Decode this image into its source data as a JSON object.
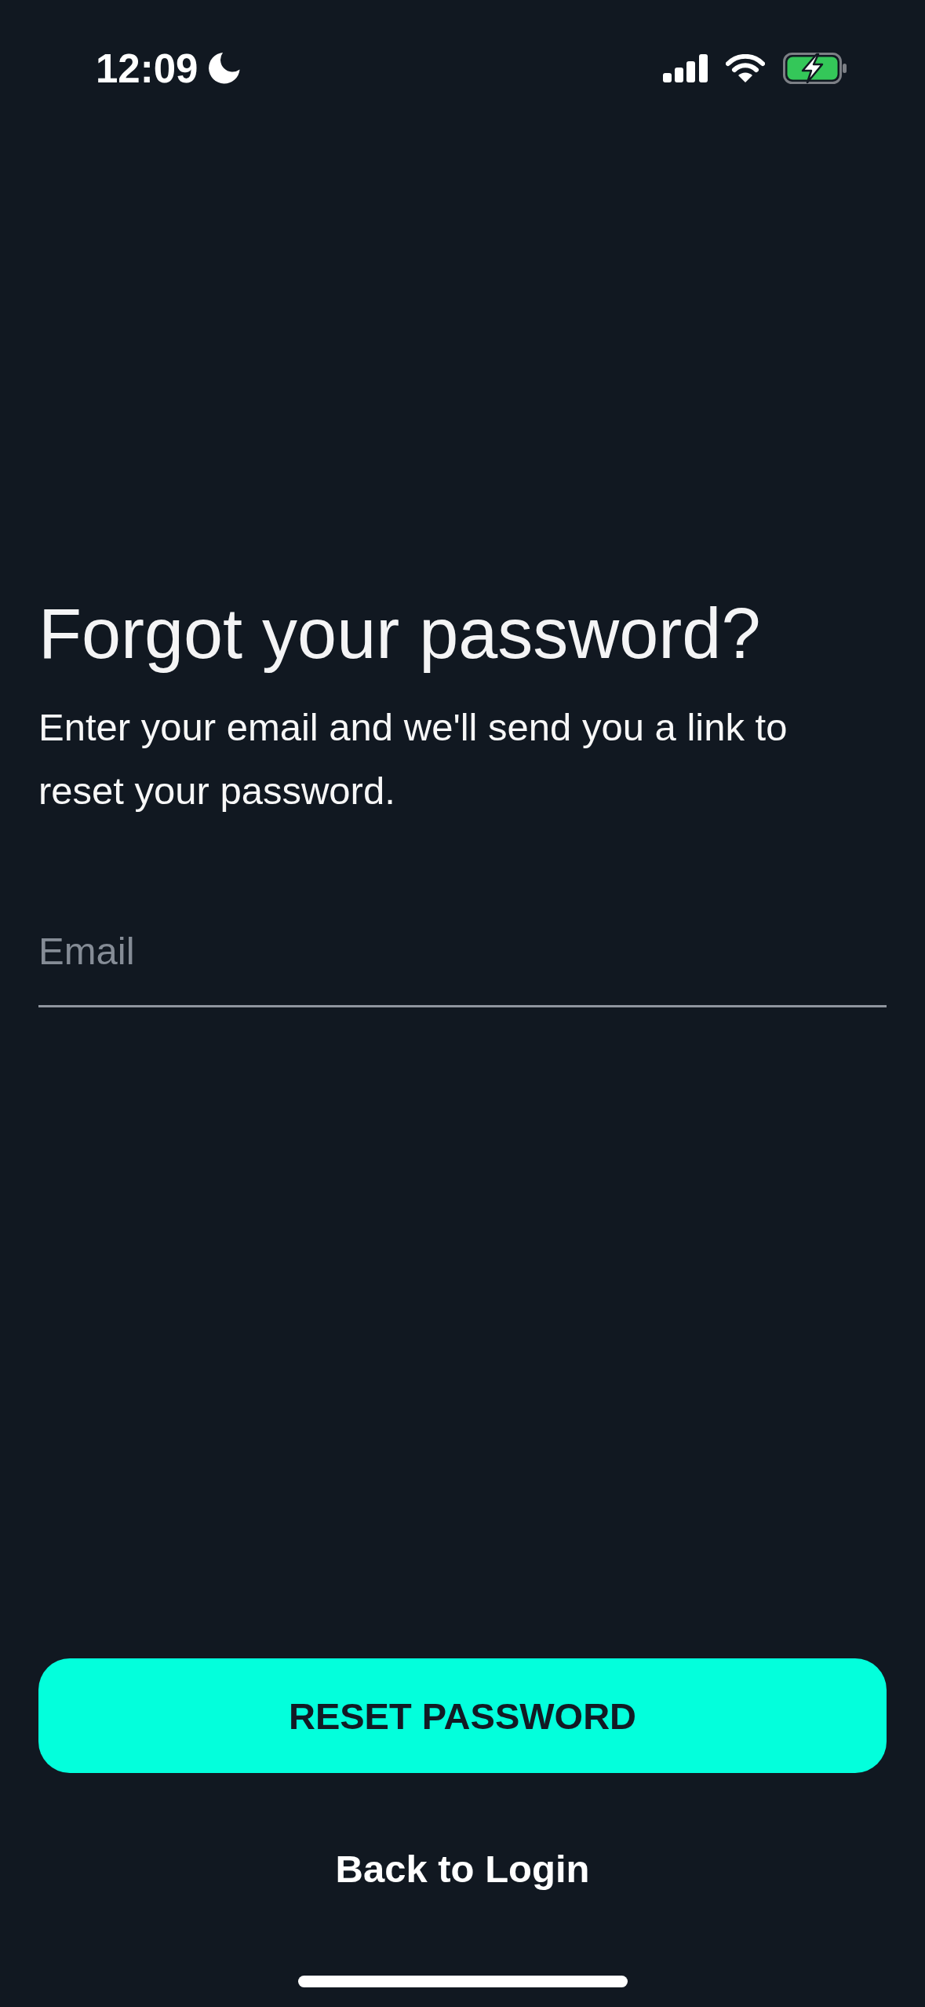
{
  "status_bar": {
    "time": "12:09"
  },
  "title": "Forgot your password?",
  "description": "Enter your email and we'll send you a link to reset your password.",
  "email_field": {
    "placeholder": "Email"
  },
  "primary_button": {
    "label": "RESET PASSWORD"
  },
  "secondary_link": {
    "label": "Back to Login"
  }
}
